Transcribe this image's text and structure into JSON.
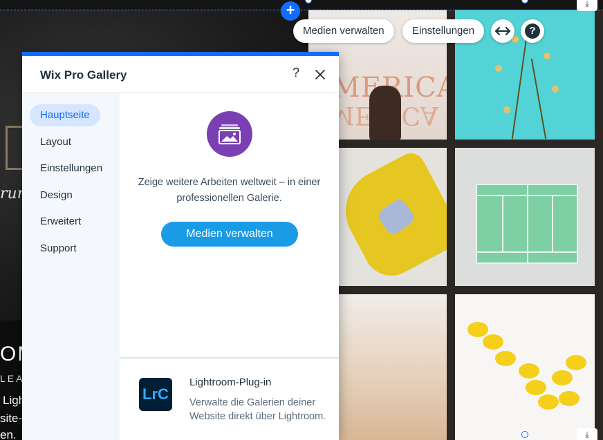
{
  "background": {
    "script_text": "rum",
    "big_text": "OM",
    "small_text": "LEAN",
    "line1": "Ligh",
    "line2": "site-T",
    "line3": "en."
  },
  "gallery": {
    "neon_word": "AMERICA"
  },
  "toolbar": {
    "add_label": "+",
    "manage_media_label": "Medien verwalten",
    "settings_label": "Einstellungen",
    "stretch_icon": "horizontal-arrows-icon",
    "help_label": "?",
    "download_icon": "download-icon"
  },
  "panel": {
    "title": "Wix Pro Gallery",
    "help_label": "?",
    "accent_color": "#116dff",
    "nav": [
      {
        "label": "Hauptseite",
        "active": true
      },
      {
        "label": "Layout"
      },
      {
        "label": "Einstellungen"
      },
      {
        "label": "Design"
      },
      {
        "label": "Erweitert"
      },
      {
        "label": "Support"
      }
    ],
    "promo": {
      "icon": "gallery-image-icon",
      "icon_color": "#7b3fb4",
      "text": "Zeige weitere Arbeiten weltweit – in einer professionellen Galerie.",
      "button_label": "Medien verwalten",
      "button_color": "#1a9be6"
    },
    "lightroom": {
      "logo_text": "LrC",
      "title": "Lightroom-Plug-in",
      "description": "Verwalte die Galerien deiner Website direkt über Lightroom."
    }
  }
}
